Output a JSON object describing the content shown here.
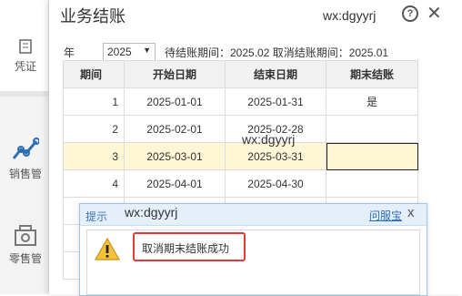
{
  "background": {
    "sidebar": [
      {
        "label": "凭证",
        "icon": "voucher-icon"
      },
      {
        "label": "销售管",
        "icon": "chart-icon"
      },
      {
        "label": "零售管",
        "icon": "store-icon"
      }
    ]
  },
  "dialog": {
    "title": "业务结账",
    "help": "?",
    "close": "✕",
    "watermarks": [
      "wx:dgyyrj",
      "wx:dgyyrj",
      "wx:dgyyrj"
    ],
    "filter": {
      "year_label": "年度:",
      "year_value": "2025",
      "period_info": "待结账期间：2025.02   取消结账期间：2025.01"
    },
    "table": {
      "headers": [
        "期间",
        "开始日期",
        "结束日期",
        "期末结账"
      ],
      "rows": [
        {
          "period": "1",
          "start": "2025-01-01",
          "end": "2025-01-31",
          "closed": "是"
        },
        {
          "period": "2",
          "start": "2025-02-01",
          "end": "2025-02-28",
          "closed": ""
        },
        {
          "period": "3",
          "start": "2025-03-01",
          "end": "2025-03-31",
          "closed": ""
        },
        {
          "period": "4",
          "start": "2025-04-01",
          "end": "2025-04-30",
          "closed": ""
        }
      ]
    }
  },
  "toast": {
    "title": "提示",
    "link": "问服宝",
    "close": "x",
    "message": "取消期末结账成功",
    "icon": "warning-icon",
    "highlight_color": "#e53935"
  }
}
